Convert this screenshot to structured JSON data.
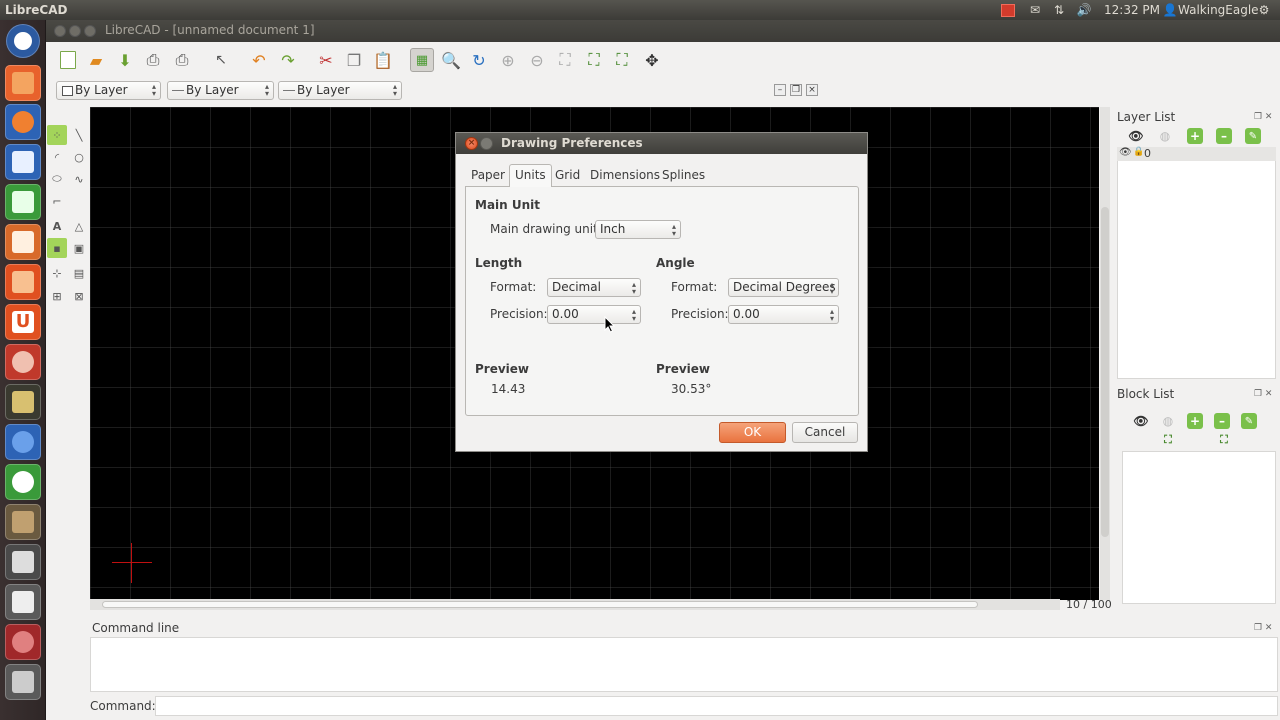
{
  "topbar": {
    "app_name": "LibreCAD",
    "time": "12:32 PM",
    "user": "WalkingEagle",
    "icons": [
      "record-icon",
      "mail-icon",
      "network-icon",
      "volume-icon",
      "user-icon",
      "gear-icon"
    ]
  },
  "window": {
    "title": "LibreCAD - [unnamed document 1]"
  },
  "toolbar2": {
    "color_combo": "By Layer",
    "linetype_combo": "By Layer",
    "linewidth_combo": "By Layer"
  },
  "layer_list": {
    "title": "Layer List",
    "layers": [
      {
        "name": "0"
      }
    ]
  },
  "block_list": {
    "title": "Block List"
  },
  "zoom_readout": "10 / 100",
  "command": {
    "title": "Command line",
    "prompt_label": "Command:"
  },
  "dialog": {
    "title": "Drawing Preferences",
    "tabs": [
      "Paper",
      "Units",
      "Grid",
      "Dimensions",
      "Splines"
    ],
    "selected_tab": "Units",
    "main_unit": {
      "heading": "Main Unit",
      "label": "Main drawing unit:",
      "value": "Inch"
    },
    "length": {
      "heading": "Length",
      "format_label": "Format:",
      "format_value": "Decimal",
      "precision_label": "Precision:",
      "precision_value": "0.00",
      "preview_heading": "Preview",
      "preview_value": "14.43"
    },
    "angle": {
      "heading": "Angle",
      "format_label": "Format:",
      "format_value": "Decimal Degrees",
      "precision_label": "Precision:",
      "precision_value": "0.00",
      "preview_heading": "Preview",
      "preview_value": "30.53°"
    },
    "ok_label": "OK",
    "cancel_label": "Cancel"
  }
}
